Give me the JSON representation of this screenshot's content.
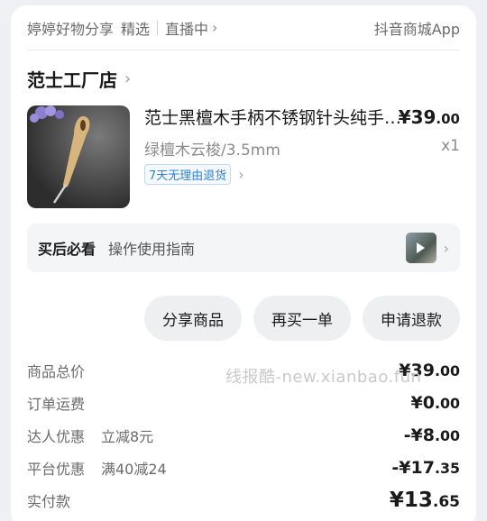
{
  "topbar": {
    "shop_channel": "婷婷好物分享",
    "featured": "精选",
    "live": "直播中",
    "app": "抖音商城App"
  },
  "shop": {
    "name": "范士工厂店"
  },
  "product": {
    "title": "范士黑檀木手柄不锈钢针头纯手工钩针",
    "price_main": "¥39",
    "price_dec": ".00",
    "variant": "绿檀木云梭/3.5mm",
    "qty": "x1",
    "return_tag": "7天无理由退货"
  },
  "guide": {
    "label": "买后必看",
    "text": "操作使用指南"
  },
  "actions": {
    "share": "分享商品",
    "rebuy": "再买一单",
    "refund": "申请退款"
  },
  "summary": {
    "total_label": "商品总价",
    "total_main": "¥39",
    "total_dec": ".00",
    "shipping_label": "订单运费",
    "shipping_main": "¥0",
    "shipping_dec": ".00",
    "creator_label": "达人优惠",
    "creator_sub": "立减8元",
    "creator_main": "-¥8",
    "creator_dec": ".00",
    "platform_label": "平台优惠",
    "platform_sub": "满40减24",
    "platform_main": "-¥17",
    "platform_dec": ".35",
    "paid_label": "实付款",
    "paid_main": "¥13",
    "paid_dec": ".65"
  },
  "watermark": "线报酷-new.xianbao.fun"
}
